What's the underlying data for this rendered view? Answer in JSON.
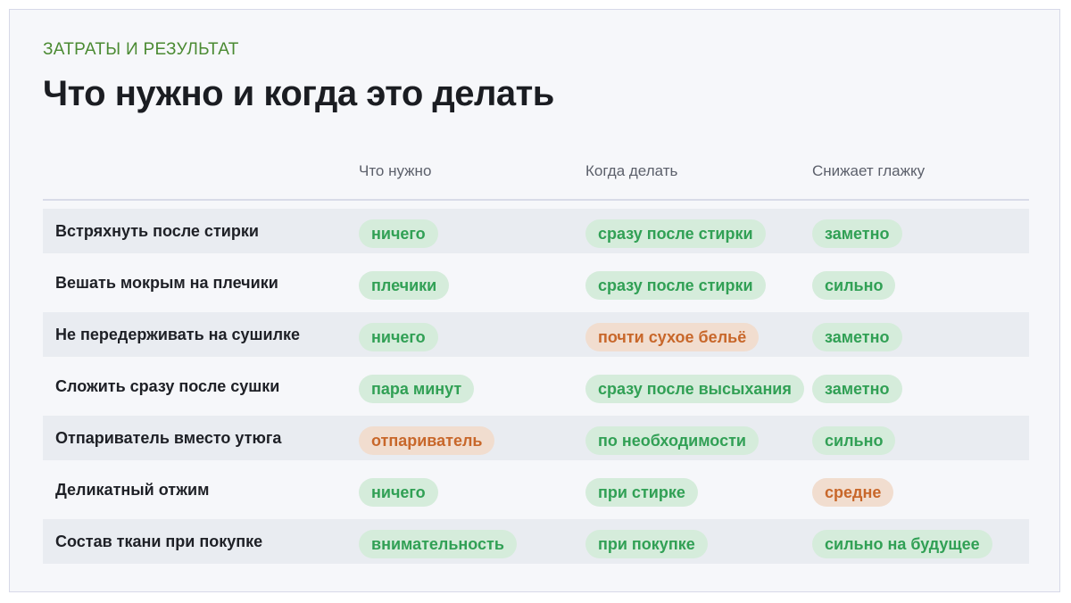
{
  "header": {
    "eyebrow": "ЗАТРАТЫ И РЕЗУЛЬТАТ",
    "title": "Что нужно и когда это делать"
  },
  "table": {
    "columns": [
      "",
      "Что нужно",
      "Когда делать",
      "Снижает глажку"
    ],
    "rows": [
      {
        "label": "Встряхнуть после стирки",
        "cells": [
          {
            "text": "ничего",
            "tone": "green"
          },
          {
            "text": "сразу после стирки",
            "tone": "green"
          },
          {
            "text": "заметно",
            "tone": "green"
          }
        ]
      },
      {
        "label": "Вешать мокрым на плечики",
        "cells": [
          {
            "text": "плечики",
            "tone": "green"
          },
          {
            "text": "сразу после стирки",
            "tone": "green"
          },
          {
            "text": "сильно",
            "tone": "green"
          }
        ]
      },
      {
        "label": "Не передерживать на сушилке",
        "cells": [
          {
            "text": "ничего",
            "tone": "green"
          },
          {
            "text": "почти сухое бельё",
            "tone": "orange"
          },
          {
            "text": "заметно",
            "tone": "green"
          }
        ]
      },
      {
        "label": "Сложить сразу после сушки",
        "cells": [
          {
            "text": "пара минут",
            "tone": "green"
          },
          {
            "text": "сразу после высыхания",
            "tone": "green"
          },
          {
            "text": "заметно",
            "tone": "green"
          }
        ]
      },
      {
        "label": "Отпариватель вместо утюга",
        "cells": [
          {
            "text": "отпариватель",
            "tone": "orange"
          },
          {
            "text": "по необходимости",
            "tone": "green"
          },
          {
            "text": "сильно",
            "tone": "green"
          }
        ]
      },
      {
        "label": "Деликатный отжим",
        "cells": [
          {
            "text": "ничего",
            "tone": "green"
          },
          {
            "text": "при стирке",
            "tone": "green"
          },
          {
            "text": "средне",
            "tone": "orange"
          }
        ]
      },
      {
        "label": "Состав ткани при покупке",
        "cells": [
          {
            "text": "внимательность",
            "tone": "green"
          },
          {
            "text": "при покупке",
            "tone": "green"
          },
          {
            "text": "сильно на будущее",
            "tone": "green"
          }
        ]
      }
    ]
  },
  "colors": {
    "eyebrow": "#4a8a32",
    "pill_green_bg": "#d5ecdb",
    "pill_green_text": "#31a055",
    "pill_orange_bg": "#f1ddcf",
    "pill_orange_text": "#c8672a"
  }
}
